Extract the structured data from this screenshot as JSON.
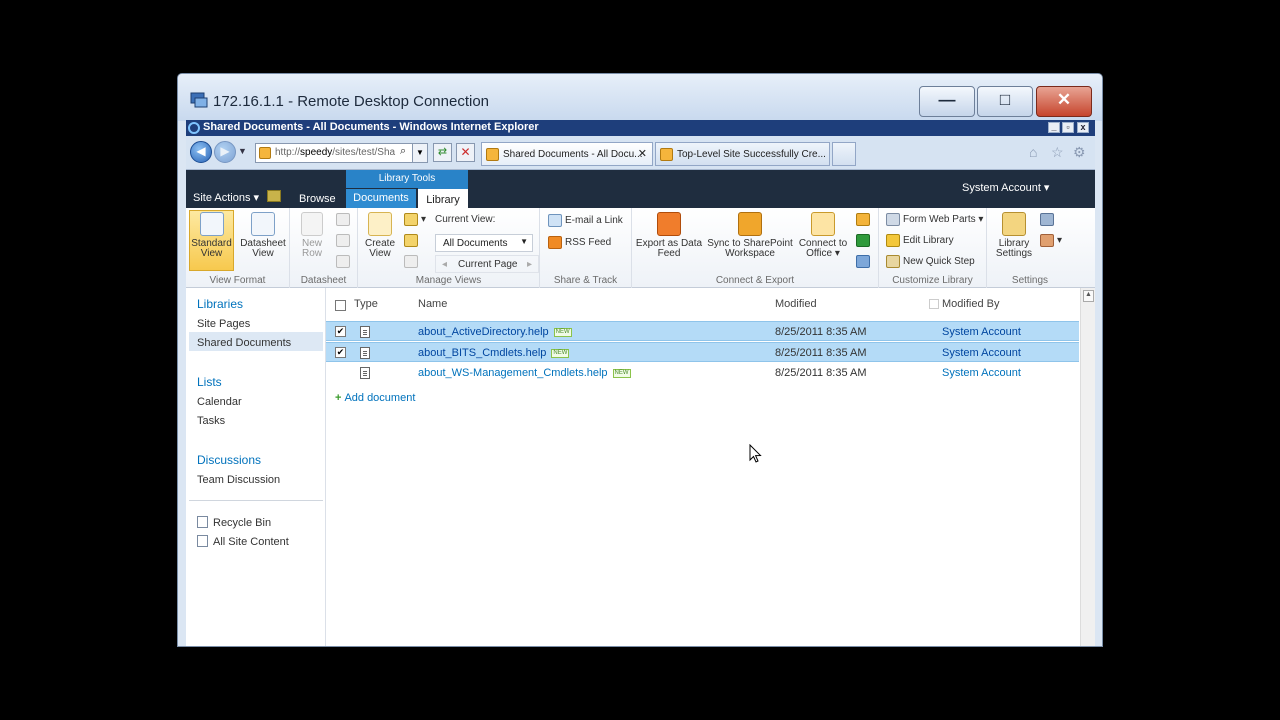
{
  "rdp": {
    "title": "172.16.1.1 - Remote Desktop Connection",
    "min": "—",
    "max": "□",
    "close": "✕"
  },
  "ie": {
    "title": "Shared Documents - All Documents - Windows Internet Explorer",
    "address_prefix": "http://",
    "address_host": "speedy",
    "address_path": "/sites/test/Sha",
    "tabs": [
      "Shared Documents - All Docu...",
      "Top-Level Site Successfully Cre..."
    ],
    "tab_close": "✕"
  },
  "sp": {
    "site_actions": "Site Actions ▾",
    "browse": "Browse",
    "library_tools": "Library Tools",
    "tab_documents": "Documents",
    "tab_library": "Library",
    "user": "System Account ▾"
  },
  "ribbon": {
    "view_format": {
      "label": "View Format",
      "standard": "Standard View",
      "datasheet": "Datasheet View"
    },
    "datasheet": {
      "label": "Datasheet",
      "new_row": "New Row"
    },
    "manage_views": {
      "label": "Manage Views",
      "create": "Create View",
      "current_view": "Current View:",
      "view_value": "All Documents",
      "current_page": "Current Page"
    },
    "share_track": {
      "label": "Share & Track",
      "email": "E-mail a Link",
      "rss": "RSS Feed"
    },
    "connect_export": {
      "label": "Connect & Export",
      "export": "Export as Data Feed",
      "sync": "Sync to SharePoint Workspace",
      "connect": "Connect to Office ▾"
    },
    "customize": {
      "label": "Customize Library",
      "form_web_parts": "Form Web Parts ▾",
      "edit_library": "Edit Library",
      "quick_step": "New Quick Step"
    },
    "settings": {
      "label": "Settings",
      "library_settings": "Library Settings"
    }
  },
  "nav": {
    "libraries": "Libraries",
    "site_pages": "Site Pages",
    "shared_documents": "Shared Documents",
    "lists": "Lists",
    "calendar": "Calendar",
    "tasks": "Tasks",
    "discussions": "Discussions",
    "team_discussion": "Team Discussion",
    "recycle_bin": "Recycle Bin",
    "all_site_content": "All Site Content"
  },
  "list": {
    "headers": {
      "type": "Type",
      "name": "Name",
      "modified": "Modified",
      "modified_by": "Modified By"
    },
    "rows": [
      {
        "name": "about_ActiveDirectory.help",
        "badge": "NEW",
        "modified": "8/25/2011 8:35 AM",
        "by": "System Account",
        "checked": "✔"
      },
      {
        "name": "about_BITS_Cmdlets.help",
        "badge": "NEW",
        "modified": "8/25/2011 8:35 AM",
        "by": "System Account",
        "checked": "✔"
      },
      {
        "name": "about_WS-Management_Cmdlets.help",
        "badge": "NEW",
        "modified": "8/25/2011 8:35 AM",
        "by": "System Account",
        "checked": ""
      }
    ],
    "add_document": "Add document"
  }
}
